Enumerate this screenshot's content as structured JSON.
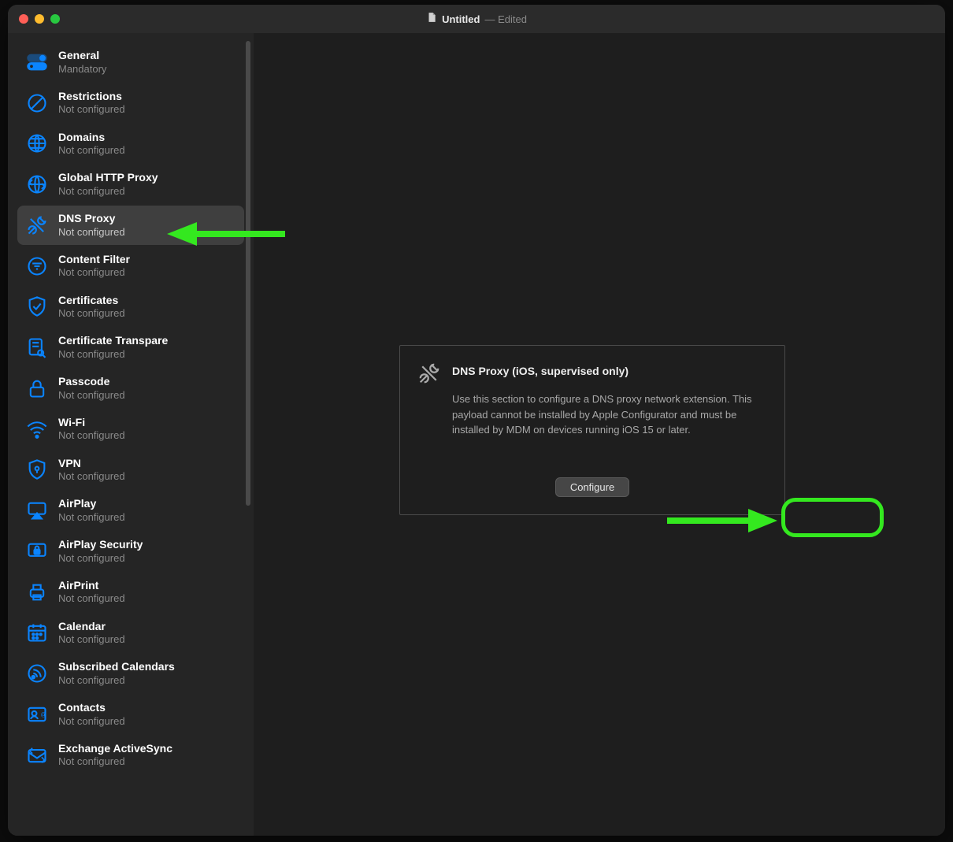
{
  "title": {
    "doc": "Untitled",
    "suffix": "— Edited"
  },
  "sidebar": {
    "selected_index": 4,
    "items": [
      {
        "label": "General",
        "sub": "Mandatory",
        "icon": "toggle"
      },
      {
        "label": "Restrictions",
        "sub": "Not configured",
        "icon": "no"
      },
      {
        "label": "Domains",
        "sub": "Not configured",
        "icon": "globe"
      },
      {
        "label": "Global HTTP Proxy",
        "sub": "Not configured",
        "icon": "globe-arrows"
      },
      {
        "label": "DNS Proxy",
        "sub": "Not configured",
        "icon": "tools"
      },
      {
        "label": "Content Filter",
        "sub": "Not configured",
        "icon": "filter"
      },
      {
        "label": "Certificates",
        "sub": "Not configured",
        "icon": "cert"
      },
      {
        "label": "Certificate Transpare",
        "sub": "Not configured",
        "icon": "cert-search"
      },
      {
        "label": "Passcode",
        "sub": "Not configured",
        "icon": "lock"
      },
      {
        "label": "Wi-Fi",
        "sub": "Not configured",
        "icon": "wifi"
      },
      {
        "label": "VPN",
        "sub": "Not configured",
        "icon": "shield"
      },
      {
        "label": "AirPlay",
        "sub": "Not configured",
        "icon": "airplay"
      },
      {
        "label": "AirPlay Security",
        "sub": "Not configured",
        "icon": "airplay-lock"
      },
      {
        "label": "AirPrint",
        "sub": "Not configured",
        "icon": "printer"
      },
      {
        "label": "Calendar",
        "sub": "Not configured",
        "icon": "calendar"
      },
      {
        "label": "Subscribed Calendars",
        "sub": "Not configured",
        "icon": "subscribed"
      },
      {
        "label": "Contacts",
        "sub": "Not configured",
        "icon": "contacts"
      },
      {
        "label": "Exchange ActiveSync",
        "sub": "Not configured",
        "icon": "exchange"
      }
    ]
  },
  "panel": {
    "title": "DNS Proxy (iOS, supervised only)",
    "description": "Use this section to configure a DNS proxy network extension. This payload cannot be installed by Apple Configurator and must be installed by MDM on devices running iOS 15 or later.",
    "button": "Configure"
  },
  "colors": {
    "accent": "#0a84ff",
    "annotation": "#34e81f"
  }
}
